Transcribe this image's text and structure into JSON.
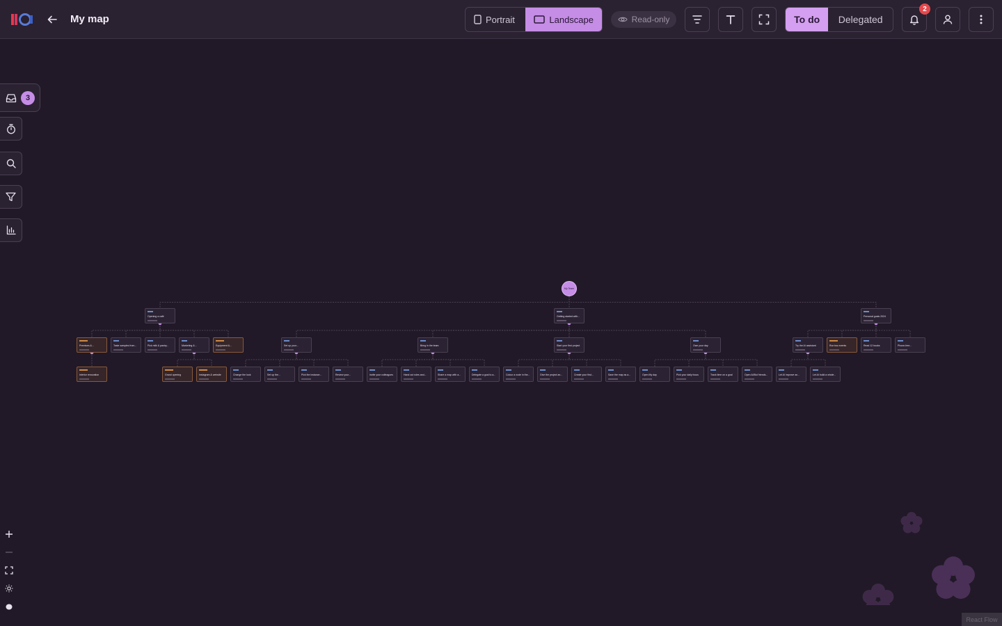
{
  "header": {
    "title": "My map",
    "orientation": {
      "portrait": "Portrait",
      "landscape": "Landscape",
      "selected": "landscape"
    },
    "readonly_label": "Read-only",
    "filter_tabs": {
      "todo": "To do",
      "delegated": "Delegated",
      "selected": "todo"
    },
    "notifications_count": "2"
  },
  "sidebar": {
    "inbox_count": "3",
    "icons": [
      "inbox-icon",
      "timer-icon",
      "search-icon",
      "filter-icon",
      "chart-icon"
    ]
  },
  "zoom_controls": [
    "zoom-in-icon",
    "zoom-out-icon",
    "fit-view-icon",
    "theme-icon",
    "lock-icon"
  ],
  "watermark": "React Flow",
  "colors": {
    "accent": "#c58de6",
    "background": "#211927",
    "warm_node": "#8a5a3a",
    "badge": "#e5484d"
  },
  "map": {
    "root": "My Team",
    "level1": [
      "Opening a café",
      "Getting started with...",
      "Personal goals 2024"
    ],
    "level2": [
      "Premises &...",
      "Taste samples from...",
      "Pick milk & pastry...",
      "Marketing &...",
      "Equipment &...",
      "Set up your...",
      "Bring in the team",
      "Start your first project",
      "Own your day",
      "Try the AI assistant",
      "Run two events",
      "Read 12 books",
      "Phone-free..."
    ],
    "level3": [
      "Interior renovation",
      "Grand opening",
      "Instagram & website",
      "Change the look",
      "Set up the...",
      "Pick the instance...",
      "Review your...",
      "Invite your colleagues",
      "Hand out roles and...",
      "Share a map with a...",
      "Delegate a goal to a...",
      "Colour a node in the...",
      "Give the project an...",
      "Create your first...",
      "Save the map as a...",
      "Open My day",
      "Pick your daily focus",
      "Track time on a goal",
      "Open AI/Bot friends...",
      "Let AI improve an...",
      "Let AI build a whole..."
    ]
  }
}
